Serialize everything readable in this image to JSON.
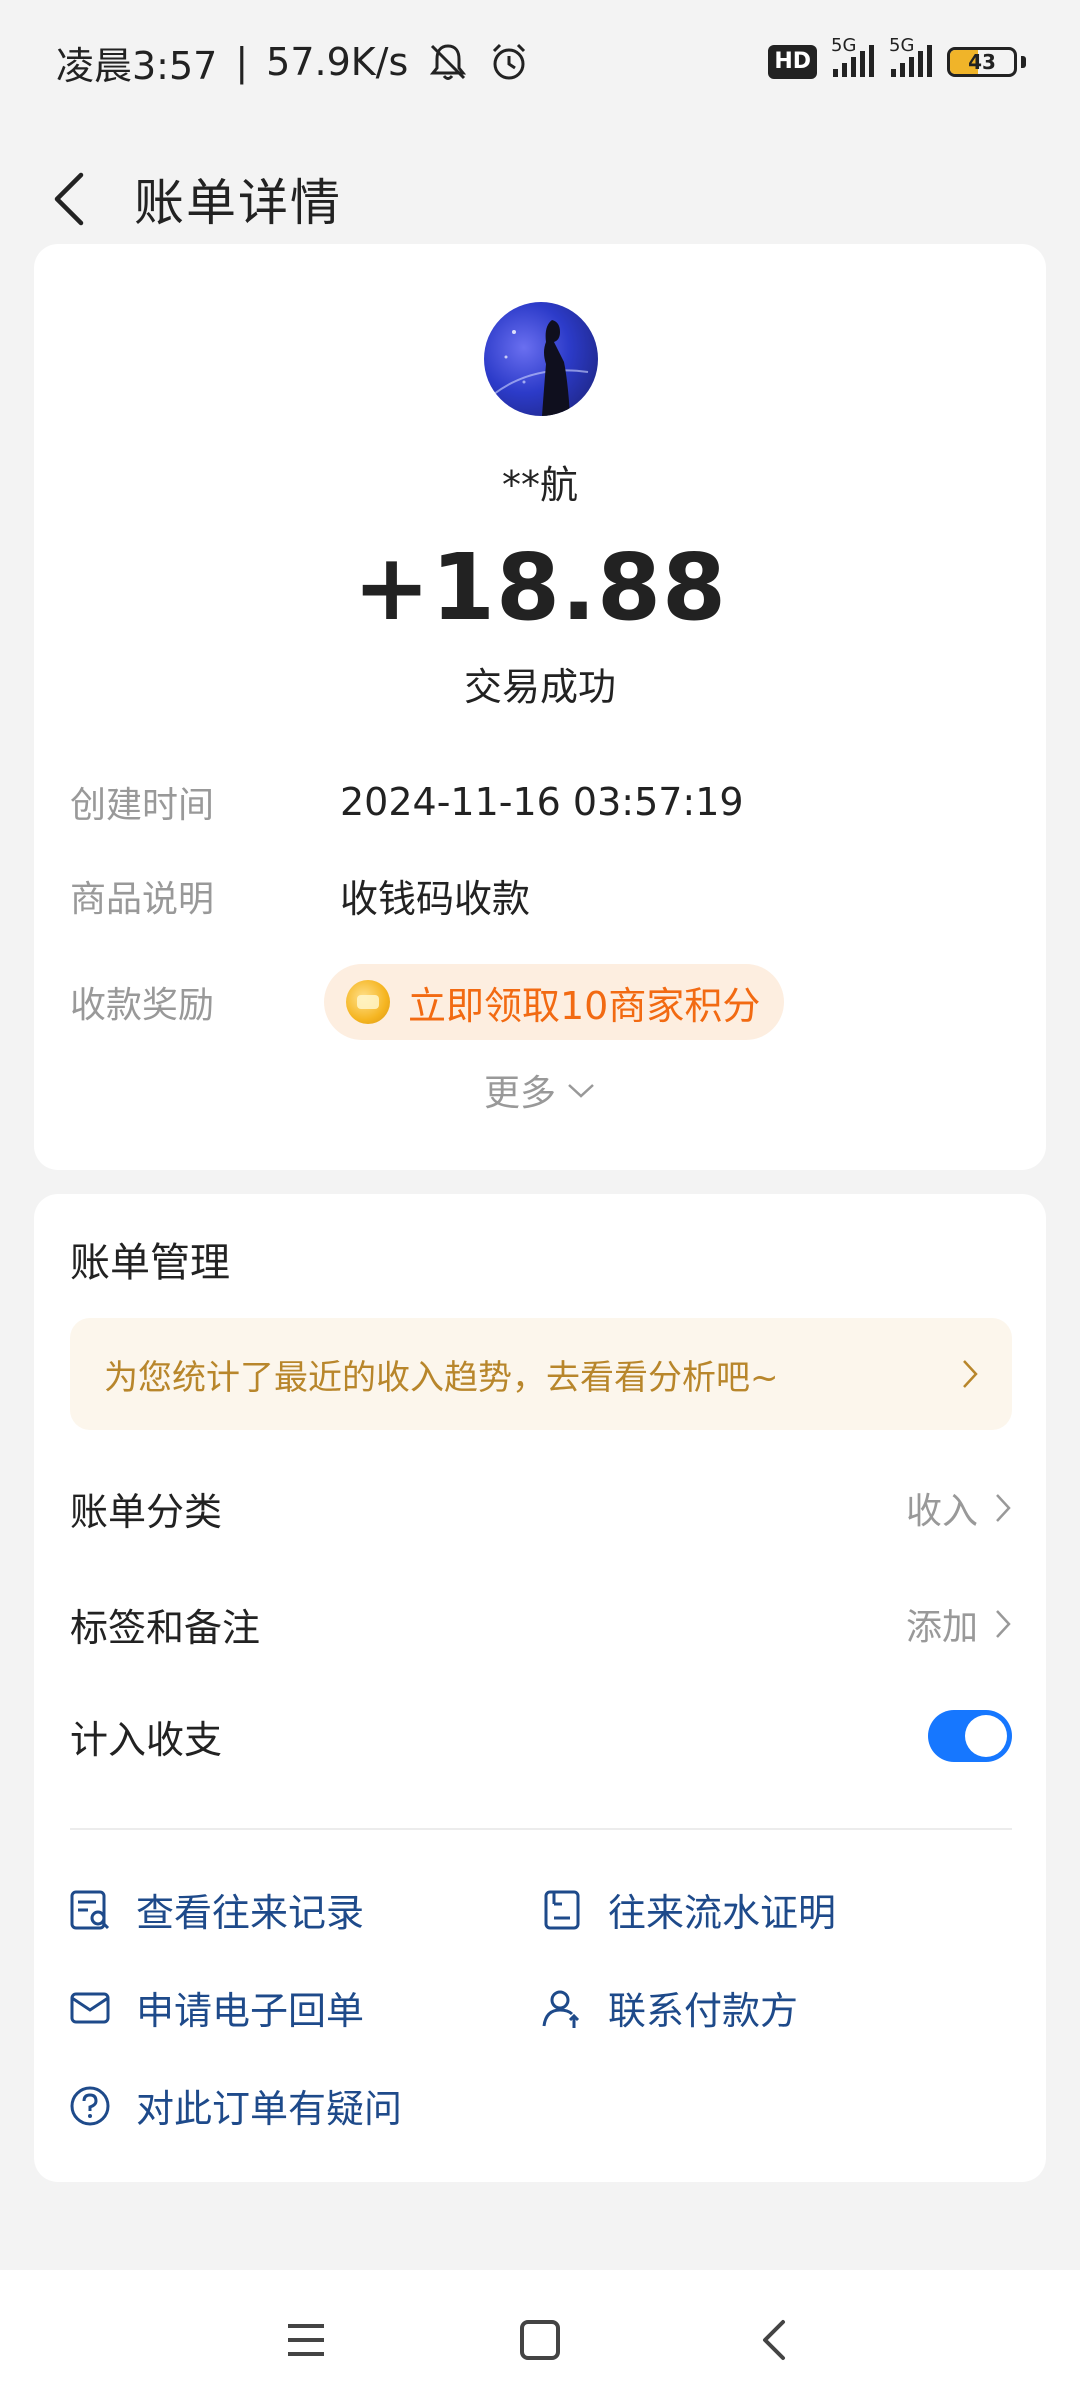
{
  "status_bar": {
    "time": "凌晨3:57",
    "speed": "57.9K/s",
    "hd_badge": "HD",
    "net1": "5G",
    "net2": "5G",
    "battery": "43",
    "battery_level": 0.43
  },
  "header": {
    "title": "账单详情"
  },
  "transaction": {
    "payer": "**航",
    "amount": "+18.88",
    "status": "交易成功",
    "fields": [
      {
        "label": "创建时间",
        "value": "2024-11-16 03:57:19"
      },
      {
        "label": "商品说明",
        "value": "收钱码收款"
      },
      {
        "label": "收款奖励",
        "value": "立即领取10商家积分"
      }
    ],
    "more": "更多"
  },
  "management": {
    "title": "账单管理",
    "tip": "为您统计了最近的收入趋势，去看看分析吧~",
    "rows": [
      {
        "label": "账单分类",
        "value": "收入"
      },
      {
        "label": "标签和备注",
        "value": "添加"
      },
      {
        "label": "计入收支",
        "toggle": true
      }
    ],
    "links": [
      {
        "label": "查看往来记录",
        "icon": "record-search-icon"
      },
      {
        "label": "往来流水证明",
        "icon": "document-proof-icon"
      },
      {
        "label": "申请电子回单",
        "icon": "mail-icon"
      },
      {
        "label": "联系付款方",
        "icon": "contact-person-icon"
      },
      {
        "label": "对此订单有疑问",
        "icon": "question-icon"
      }
    ]
  },
  "colors": {
    "accent": "#1677ff",
    "reward": "#f26a12",
    "link": "#1e4a8a",
    "tip": "#b8862b"
  }
}
